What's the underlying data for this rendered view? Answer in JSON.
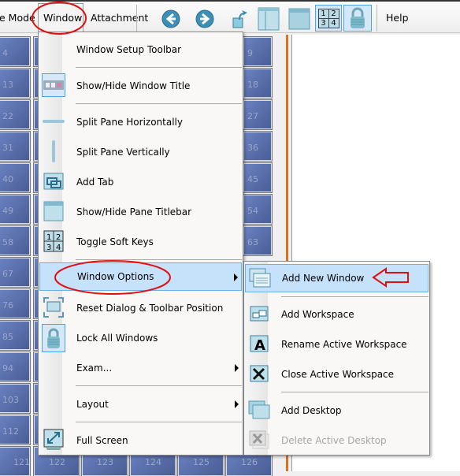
{
  "menubar": {
    "items": [
      {
        "label": "e Mode"
      },
      {
        "label": "Window"
      },
      {
        "label": "Attachment"
      },
      {
        "label": "Help"
      }
    ]
  },
  "toolbar": {
    "icons": [
      "back-arrow-icon",
      "forward-arrow-icon",
      "open-folder-arrow-icon",
      "split-pane-icon",
      "window-icon",
      "soft-keys-1234-icon",
      "lock-icon"
    ],
    "soft_keys": [
      "1",
      "2",
      "3",
      "4"
    ]
  },
  "grid": {
    "left_column": [
      "4",
      "13",
      "22",
      "31",
      "40",
      "49",
      "58",
      "67",
      "76",
      "85",
      "94",
      "103",
      "112",
      "121"
    ],
    "right_column": [
      "9",
      "18",
      "27",
      "36",
      "45",
      "54",
      "63"
    ],
    "bottom_row": [
      "122",
      "123",
      "124",
      "125",
      "126"
    ]
  },
  "window_menu": {
    "items": [
      {
        "label": "Window Setup Toolbar"
      },
      {
        "label": "Show/Hide Window Title",
        "icon": "window-title-icon"
      },
      {
        "label": "Split Pane Horizontally",
        "icon": "horizontal-bar-icon"
      },
      {
        "label": "Split Pane Vertically",
        "icon": "vertical-bar-icon"
      },
      {
        "label": "Add Tab",
        "icon": "add-tab-icon"
      },
      {
        "label": "Show/Hide Pane Titlebar",
        "icon": "pane-titlebar-icon"
      },
      {
        "label": "Toggle Soft Keys",
        "icon": "soft-keys-icon"
      },
      {
        "label": "Window Options",
        "submenu": true,
        "highlighted": true
      },
      {
        "label": "Reset Dialog & Toolbar Position",
        "icon": "reset-position-icon"
      },
      {
        "label": "Lock All Windows",
        "icon": "lock-icon"
      },
      {
        "label": "Exam...",
        "submenu": true
      },
      {
        "label": "Layout",
        "submenu": true
      },
      {
        "label": "Full Screen",
        "icon": "full-screen-icon"
      }
    ]
  },
  "window_options_submenu": {
    "items": [
      {
        "label": "Add New Window",
        "icon": "add-window-icon",
        "highlighted": true
      },
      {
        "label": "Add Workspace",
        "icon": "add-workspace-icon"
      },
      {
        "label": "Rename Active Workspace",
        "icon": "rename-workspace-icon"
      },
      {
        "label": "Close Active Workspace",
        "icon": "close-workspace-icon"
      },
      {
        "label": "Add Desktop",
        "icon": "add-desktop-icon"
      },
      {
        "label": "Delete Active Desktop",
        "icon": "delete-desktop-icon",
        "disabled": true
      }
    ]
  },
  "annotations": {
    "color": "#e01010"
  }
}
